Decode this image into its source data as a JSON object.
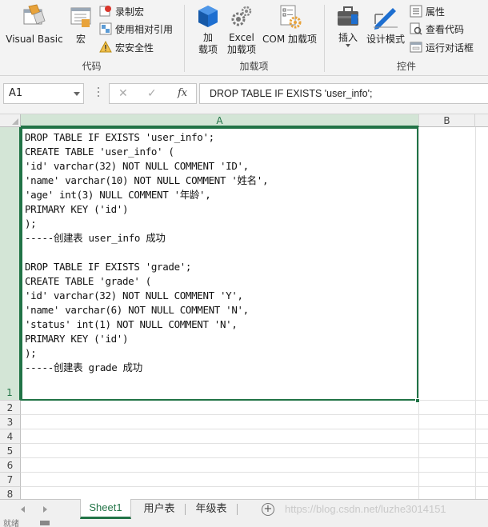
{
  "ribbon": {
    "code_group": {
      "label": "代码",
      "visual_basic": "Visual Basic",
      "macros": "宏",
      "record_macro": "录制宏",
      "relative_refs": "使用相对引用",
      "macro_security": "宏安全性"
    },
    "addins_group": {
      "label": "加载项",
      "addins_line1": "加",
      "addins_line2": "载项",
      "excel_addins_line1": "Excel",
      "excel_addins_line2": "加载项",
      "com_addins": "COM 加载项"
    },
    "controls_group": {
      "label": "控件",
      "insert": "插入",
      "design_mode": "设计模式",
      "properties": "属性",
      "view_code": "查看代码",
      "run_dialog": "运行对话框"
    }
  },
  "formula_bar": {
    "name_box": "A1",
    "cancel_glyph": "✕",
    "enter_glyph": "✓",
    "fx_label": "fx",
    "formula": "DROP TABLE IF EXISTS 'user_info';"
  },
  "grid": {
    "columns": [
      "A",
      "B"
    ],
    "rows": [
      "1",
      "2",
      "3",
      "4",
      "5",
      "6",
      "7",
      "8"
    ],
    "cell_a1_lines": [
      "DROP TABLE IF EXISTS 'user_info';",
      "CREATE TABLE 'user_info' (",
      "'id' varchar(32) NOT NULL COMMENT 'ID',",
      "'name' varchar(10) NOT NULL COMMENT '姓名',",
      "'age' int(3) NULL COMMENT '年龄',",
      "PRIMARY KEY ('id')",
      ");",
      "-----创建表 user_info 成功",
      "",
      "DROP TABLE IF EXISTS 'grade';",
      "CREATE TABLE 'grade' (",
      "'id' varchar(32) NOT NULL COMMENT 'Y',",
      "'name' varchar(6) NOT NULL COMMENT 'N',",
      "'status' int(1) NOT NULL COMMENT 'N',",
      "PRIMARY KEY ('id')",
      ");",
      "-----创建表 grade 成功"
    ]
  },
  "sheets": {
    "tabs": [
      "Sheet1",
      "用户表",
      "年级表"
    ],
    "active": "Sheet1",
    "add_glyph": "+",
    "watermark": "https://blog.csdn.net/luzhe3014151"
  },
  "status_bar": {
    "text": "就绪"
  },
  "colors": {
    "accent": "#217346",
    "ribbon_bg": "#f3f3f3"
  }
}
